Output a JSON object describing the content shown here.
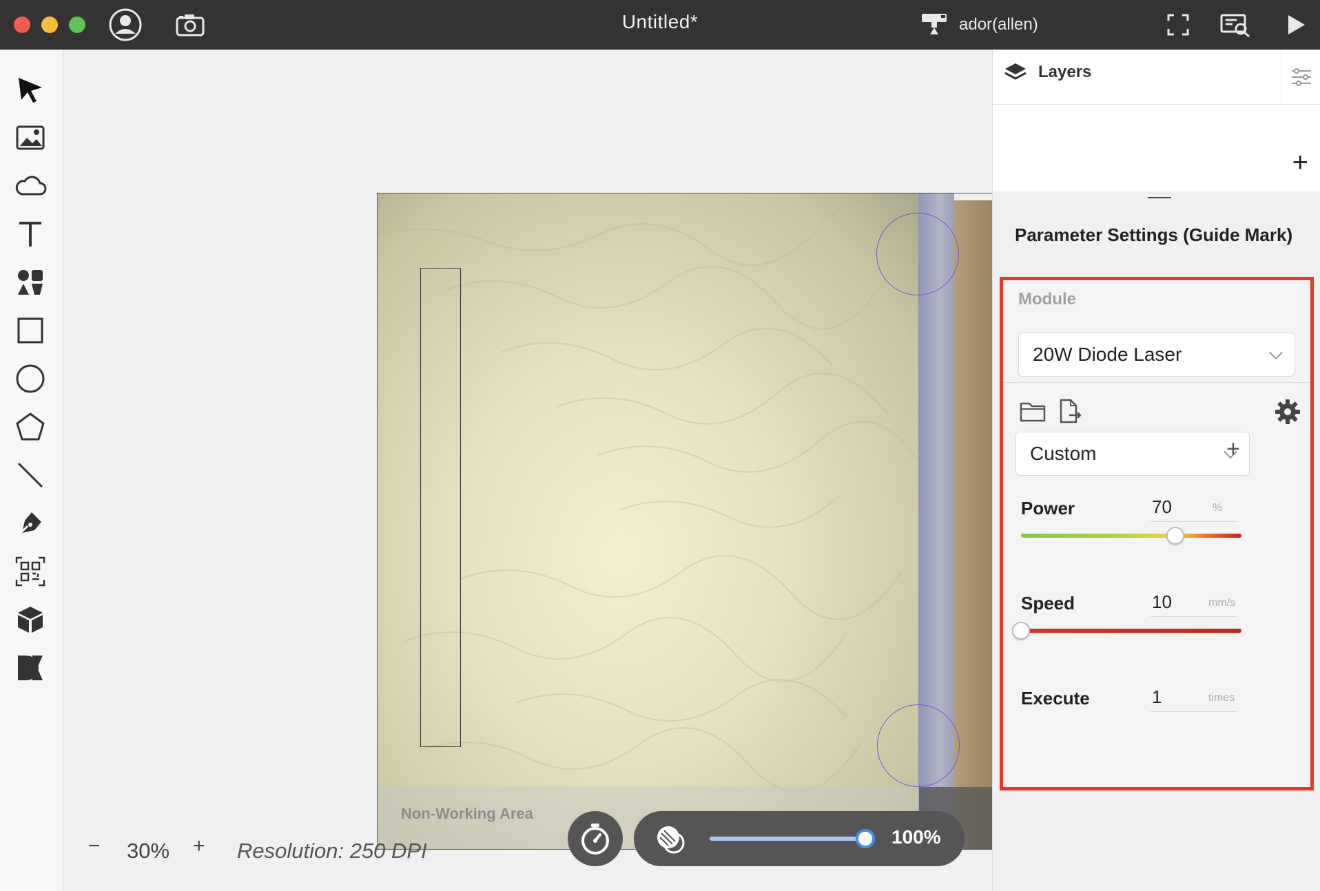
{
  "window": {
    "title": "Untitled*",
    "device_name": "ador(allen)"
  },
  "toolbar": {
    "tools": [
      "select-tool",
      "image-tool",
      "cloud-tool",
      "text-tool",
      "elements-tool",
      "rectangle-tool",
      "ellipse-tool",
      "polygon-tool",
      "line-tool",
      "pen-tool",
      "qr-code-tool",
      "3d-box-tool",
      "design-market-tool"
    ]
  },
  "canvas": {
    "non_working_label": "Non-Working Area",
    "zoom": "30%",
    "zoom_minus": "−",
    "zoom_plus": "+",
    "resolution": "Resolution: 250 DPI",
    "opacity_label": "100%",
    "opacity_value": 1.0
  },
  "panel": {
    "layers_tab": "Layers",
    "layers_add": "+",
    "parameter_title": "Parameter Settings (Guide Mark)",
    "module_label": "Module",
    "module_value": "20W Diode Laser",
    "preset_value": "Custom",
    "preset_add": "+",
    "power": {
      "label": "Power",
      "value": "70",
      "unit": "%",
      "fraction": 0.7
    },
    "speed": {
      "label": "Speed",
      "value": "10",
      "unit": "mm/s",
      "fraction": 0.0
    },
    "execute": {
      "label": "Execute",
      "value": "1",
      "unit": "times"
    }
  },
  "colors": {
    "titlebar": "#333333",
    "highlight_border": "#e53a2b",
    "guide_circle": "#7b4bd6",
    "slider_accent": "#4a90e2"
  }
}
